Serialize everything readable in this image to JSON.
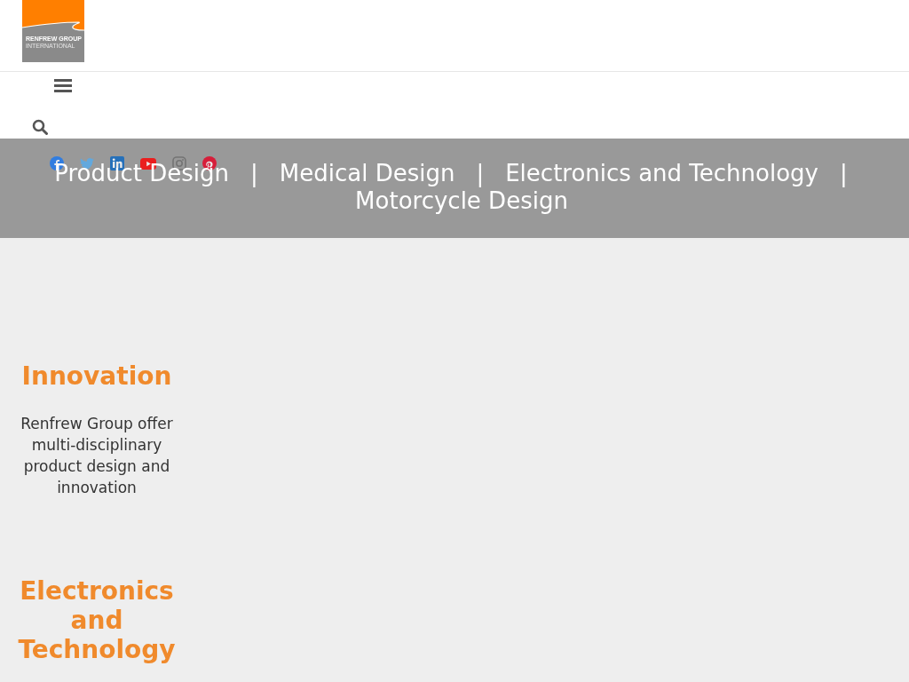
{
  "header": {
    "logo": {
      "lines": [
        "RENFREW GROUP",
        "INTERNATIONAL"
      ]
    }
  },
  "nav": {
    "items": [
      {
        "kind": "link",
        "label": "Product Design"
      },
      {
        "kind": "separator",
        "label": "|"
      },
      {
        "kind": "link",
        "label": "Medical Design"
      },
      {
        "kind": "separator",
        "label": "|"
      },
      {
        "kind": "link",
        "label": "Electronics and Technology"
      },
      {
        "kind": "separator",
        "label": "|"
      },
      {
        "kind": "link",
        "label": "Motorcycle Design"
      }
    ]
  },
  "sections": [
    {
      "heading": "Innovation",
      "text": "Renfrew Group offer multi-disciplinary product design and innovation"
    },
    {
      "heading": "Electronics and Technology"
    }
  ]
}
